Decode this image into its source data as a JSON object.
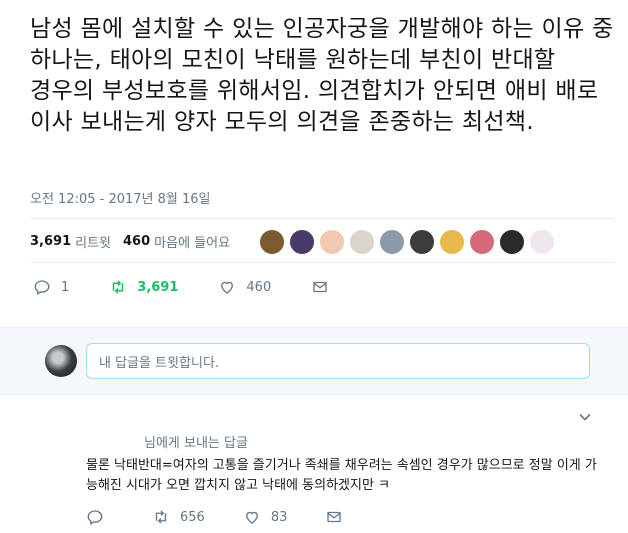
{
  "tweet": {
    "text": "남성 몸에 설치할 수 있는 인공자궁을 개발해야 하는 이유 중 하나는, 태아의 모친이 낙태를 원하는데 부친이 반대할 경우의 부성보호를 위해서임. 의견합치가 안되면 애비 배로 이사 보내는게 양자 모두의 의견을 존중하는 최선책.",
    "timestamp": "오전 12:05 - 2017년 8월 16일"
  },
  "stats": {
    "retweets_count": "3,691",
    "retweets_label": "리트윗",
    "likes_count": "460",
    "likes_label": "마음에 들어요"
  },
  "liker_avatars": [
    {
      "icon": "avatar-1",
      "color": "#7a5c2e"
    },
    {
      "icon": "avatar-2",
      "color": "#4a3a6a"
    },
    {
      "icon": "avatar-3",
      "color": "#f2c9b0"
    },
    {
      "icon": "avatar-4",
      "color": "#d9d4cc"
    },
    {
      "icon": "avatar-5",
      "color": "#8a9aa8"
    },
    {
      "icon": "avatar-6",
      "color": "#3c3c3c"
    },
    {
      "icon": "avatar-7",
      "color": "#e8b84a"
    },
    {
      "icon": "avatar-8",
      "color": "#d46a7a"
    },
    {
      "icon": "avatar-9",
      "color": "#2a2a2a"
    },
    {
      "icon": "avatar-10",
      "color": "#f0e6f0"
    }
  ],
  "actions": {
    "reply_count": "1",
    "retweet_count": "3,691",
    "like_count": "460"
  },
  "reply_box": {
    "placeholder": "내 답글을 트윗합니다."
  },
  "reply": {
    "reply_to_label": "님에게 보내는 답글",
    "text": "물론 낙태반대=여자의 고통을 즐기거나 족쇄를 채우려는 속셈인 경우가 많으므로 정말 이게 가능해진 시대가 오면 깝치지 않고 낙태에 동의하겠지만 ㅋ",
    "reply_count": "",
    "retweet_count": "656",
    "like_count": "83"
  },
  "colors": {
    "accent": "#1da1f2",
    "retweet_active": "#17bf63",
    "muted": "#657786",
    "text": "#14171a"
  }
}
